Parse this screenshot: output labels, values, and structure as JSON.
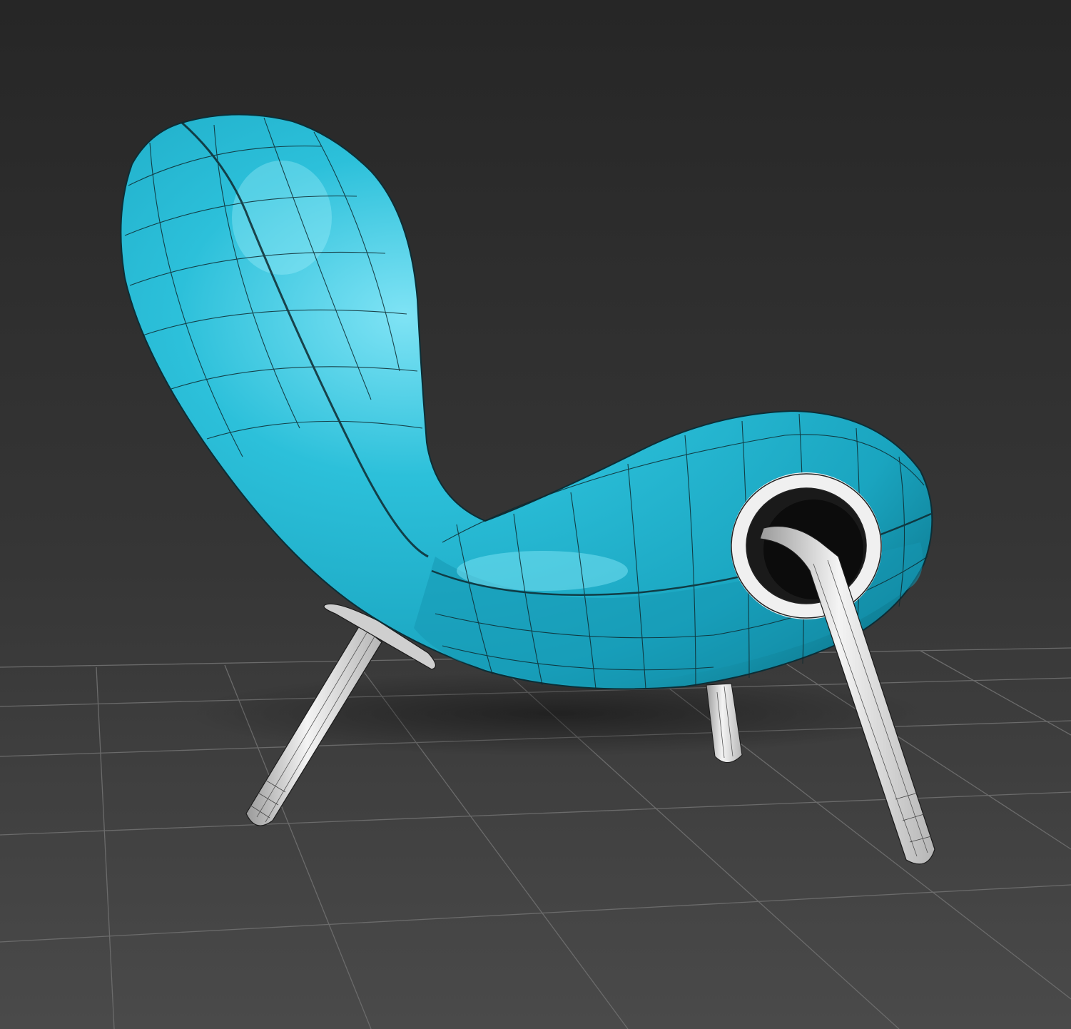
{
  "viewport": {
    "background_top": "#2a2a2a",
    "background_bottom": "#474747",
    "grid_color": "#6e6e6e",
    "grid_visible": true
  },
  "model": {
    "name": "chair",
    "shell_color": "#22b5d0",
    "shell_highlight": "#7fe3f5",
    "shell_shadow": "#0f7f96",
    "wire_color": "#0e2a30",
    "leg_color": "#e6e6e6",
    "leg_shadow": "#8a8a8a"
  }
}
